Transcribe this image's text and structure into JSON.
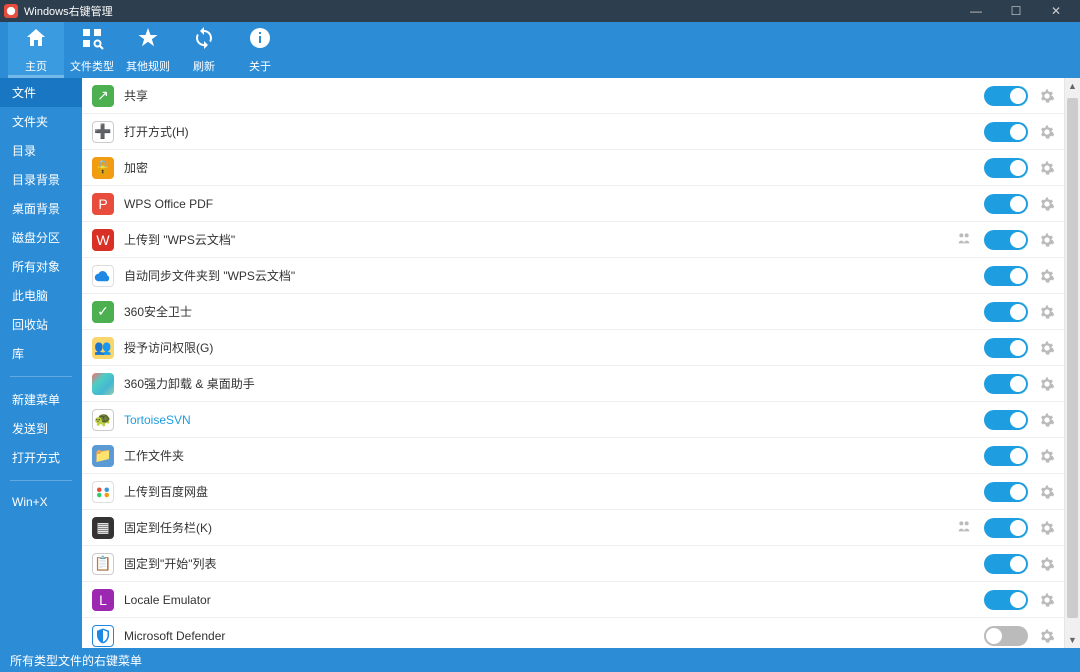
{
  "titlebar": {
    "title": "Windows右键管理"
  },
  "toolbar": [
    {
      "key": "home",
      "label": "主页",
      "active": true
    },
    {
      "key": "type",
      "label": "文件类型",
      "active": false
    },
    {
      "key": "other",
      "label": "其他规则",
      "active": false
    },
    {
      "key": "refresh",
      "label": "刷新",
      "active": false
    },
    {
      "key": "about",
      "label": "关于",
      "active": false
    }
  ],
  "sidebar": {
    "groups": [
      [
        {
          "label": "文件",
          "selected": true
        },
        {
          "label": "文件夹",
          "selected": false
        },
        {
          "label": "目录",
          "selected": false
        },
        {
          "label": "目录背景",
          "selected": false
        },
        {
          "label": "桌面背景",
          "selected": false
        },
        {
          "label": "磁盘分区",
          "selected": false
        },
        {
          "label": "所有对象",
          "selected": false
        },
        {
          "label": "此电脑",
          "selected": false
        },
        {
          "label": "回收站",
          "selected": false
        },
        {
          "label": "库",
          "selected": false
        }
      ],
      [
        {
          "label": "新建菜单",
          "selected": false
        },
        {
          "label": "发送到",
          "selected": false
        },
        {
          "label": "打开方式",
          "selected": false
        }
      ],
      [
        {
          "label": "Win+X",
          "selected": false
        }
      ]
    ]
  },
  "list": [
    {
      "iconClass": "ic-green",
      "glyph": "↗",
      "label": "共享",
      "on": true,
      "extra": false
    },
    {
      "iconClass": "ic-white",
      "glyph": "➕",
      "label": "打开方式(H)",
      "on": true,
      "extra": false
    },
    {
      "iconClass": "ic-yellow",
      "glyph": "🔒",
      "label": "加密",
      "on": true,
      "extra": false
    },
    {
      "iconClass": "ic-red",
      "glyph": "P",
      "label": "WPS Office PDF",
      "on": true,
      "extra": false
    },
    {
      "iconClass": "ic-wps",
      "glyph": "W",
      "label": "上传到 \"WPS云文档\"",
      "on": true,
      "extra": true
    },
    {
      "iconClass": "ic-cloud",
      "glyph": "",
      "label": "自动同步文件夹到 \"WPS云文档\"",
      "on": true,
      "extra": false,
      "cloud": true
    },
    {
      "iconClass": "ic-360",
      "glyph": "✓",
      "label": "360安全卫士",
      "on": true,
      "extra": false
    },
    {
      "iconClass": "ic-folder",
      "glyph": "👥",
      "label": "授予访问权限(G)",
      "on": true,
      "extra": false
    },
    {
      "iconClass": "ic-multi",
      "glyph": "",
      "label": "360强力卸载 & 桌面助手",
      "on": true,
      "extra": false
    },
    {
      "iconClass": "ic-svn",
      "glyph": "🐢",
      "label": "TortoiseSVN",
      "on": true,
      "extra": false,
      "link": true
    },
    {
      "iconClass": "ic-work",
      "glyph": "📁",
      "label": "工作文件夹",
      "on": true,
      "extra": false
    },
    {
      "iconClass": "ic-baidu",
      "glyph": "",
      "label": "上传到百度网盘",
      "on": true,
      "extra": false,
      "baidu": true
    },
    {
      "iconClass": "ic-task",
      "glyph": "▦",
      "label": "固定到任务栏(K)",
      "on": true,
      "extra": true
    },
    {
      "iconClass": "ic-start",
      "glyph": "📋",
      "label": "固定到\"开始\"列表",
      "on": true,
      "extra": false
    },
    {
      "iconClass": "ic-locale",
      "glyph": "L",
      "label": "Locale Emulator",
      "on": true,
      "extra": false
    },
    {
      "iconClass": "ic-defender",
      "glyph": "",
      "label": "Microsoft Defender",
      "on": false,
      "extra": false,
      "shield": true
    }
  ],
  "status": {
    "text": "所有类型文件的右键菜单"
  },
  "scrollbar": {
    "thumbTop": 20,
    "thumbHeight": 520
  }
}
